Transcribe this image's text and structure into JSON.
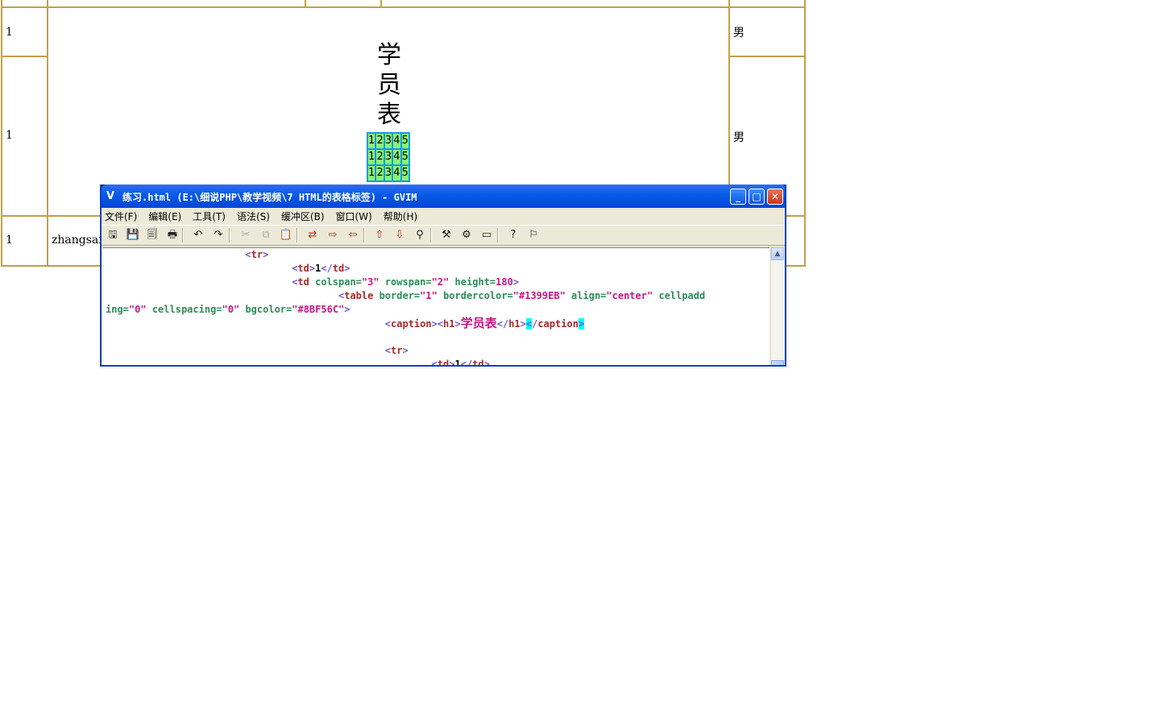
{
  "page": {
    "row_number_1": "1",
    "row_number_2": "1",
    "row_number_3": "1",
    "gender_1": "男",
    "gender_2": "男",
    "name_cell": "zhangsan",
    "caption_chars": [
      "学",
      "员",
      "表"
    ],
    "inner_rows": [
      [
        "1",
        "2",
        "3",
        "4",
        "5"
      ],
      [
        "1",
        "2",
        "3",
        "4",
        "5"
      ],
      [
        "1",
        "2",
        "3",
        "4",
        "5"
      ]
    ],
    "colors": {
      "border": "#c1a04a",
      "inner_bg": "#8BF56C",
      "inner_border": "#1399EB"
    }
  },
  "gvim": {
    "title": "练习.html (E:\\细说PHP\\教学视频\\7 HTML的表格标签) - GVIM",
    "app_icon": "vim-icon",
    "menu": [
      "文件(F)",
      "编辑(E)",
      "工具(T)",
      "语法(S)",
      "缓冲区(B)",
      "窗口(W)",
      "帮助(H)"
    ],
    "toolbar_icons": [
      "open-icon",
      "save-icon",
      "save-all-icon",
      "print-icon",
      "undo-icon",
      "redo-icon",
      "cut-icon",
      "copy-icon",
      "paste-icon",
      "replace-icon",
      "find-next-icon",
      "find-prev-icon",
      "load-session-icon",
      "save-session-icon",
      "run-script-icon",
      "make-icon",
      "shell-icon",
      "ctags-icon",
      "help-icon",
      "find-help-icon"
    ],
    "code": {
      "l1_tag": "tr",
      "l2_content": "1",
      "l3_attrs": {
        "colspan": "\"3\"",
        "rowspan": "\"2\"",
        "height": "180"
      },
      "l4_attrs": {
        "border": "\"1\"",
        "bordercolor": "\"#1399EB\"",
        "align": "\"center\"",
        "cellpadd_head": "cellpadd"
      },
      "l5_wrap": {
        "attr_tail": "ing=",
        "cellpadding_val": "\"0\"",
        "cellspacing_val": "\"0\"",
        "bgcolor_val": "\"#8BF56C\""
      },
      "l6_caption_text": "学员表",
      "l8_tag": "tr",
      "l9_content": "1"
    }
  }
}
